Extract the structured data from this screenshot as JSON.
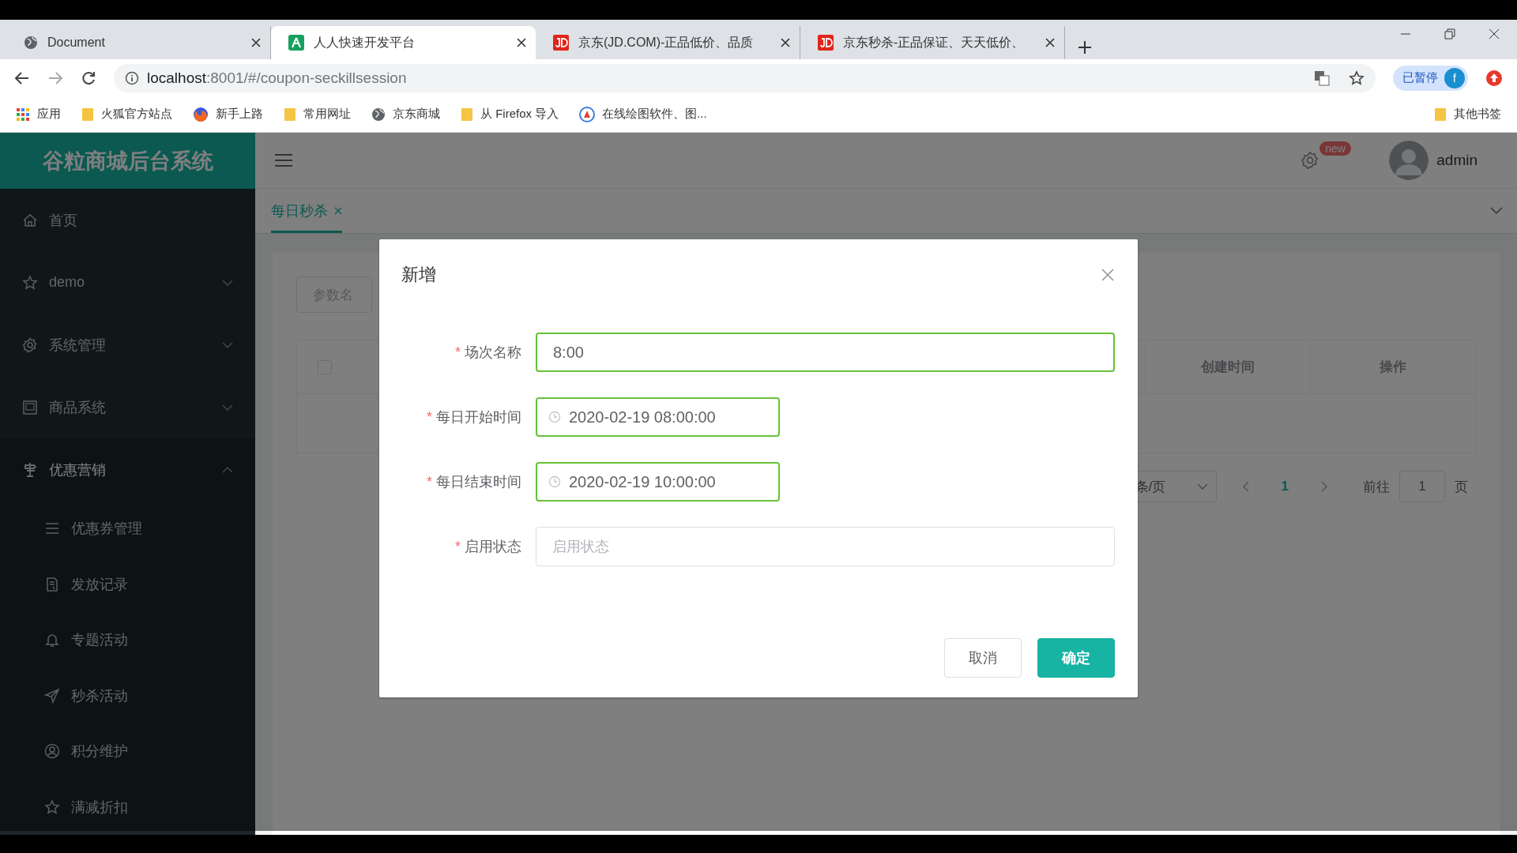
{
  "browser": {
    "tabs": [
      {
        "title": "Document",
        "selected": false
      },
      {
        "title": "人人快速开发平台",
        "selected": true
      },
      {
        "title": "京东(JD.COM)-正品低价、品质",
        "selected": false
      },
      {
        "title": "京东秒杀-正品保证、天天低价、",
        "selected": false
      }
    ],
    "address": {
      "host": "localhost",
      "rest": ":8001/#/coupon-seckillsession"
    },
    "profile": {
      "label": "已暂停",
      "initial": "f"
    },
    "bookmarks": [
      {
        "label": "应用"
      },
      {
        "label": "火狐官方站点"
      },
      {
        "label": "新手上路"
      },
      {
        "label": "常用网址"
      },
      {
        "label": "京东商城"
      },
      {
        "label": "从 Firefox 导入"
      },
      {
        "label": "在线绘图软件、图..."
      }
    ],
    "other_bookmarks": "其他书签"
  },
  "app": {
    "brand": "谷粒商城后台系统",
    "sidebar": [
      {
        "label": "首页",
        "kind": "link"
      },
      {
        "label": "demo",
        "kind": "group",
        "expanded": false
      },
      {
        "label": "系统管理",
        "kind": "group",
        "expanded": false
      },
      {
        "label": "商品系统",
        "kind": "group",
        "expanded": false
      },
      {
        "label": "优惠营销",
        "kind": "group",
        "expanded": true,
        "children": [
          {
            "label": "优惠券管理"
          },
          {
            "label": "发放记录"
          },
          {
            "label": "专题活动"
          },
          {
            "label": "秒杀活动"
          },
          {
            "label": "积分维护"
          },
          {
            "label": "满减折扣"
          }
        ]
      }
    ],
    "user": {
      "name": "admin",
      "badge": "new"
    },
    "page_tabs": [
      {
        "label": "每日秒杀",
        "selected": true
      }
    ],
    "search": {
      "placeholder": "参数名"
    },
    "table": {
      "select_all": {
        "checked": false
      },
      "columns": [
        "创建时间",
        "操作"
      ]
    },
    "pagination": {
      "page_size": "条/页",
      "current_page": "1",
      "goto_label": "前往",
      "goto_value": "1",
      "page_unit": "页"
    }
  },
  "dialog": {
    "title": "新增",
    "fields": [
      {
        "mark": "*",
        "label": "场次名称",
        "kind": "text",
        "value": "8:00"
      },
      {
        "mark": "*",
        "label": "每日开始时间",
        "kind": "datetime",
        "value": "2020-02-19 08:00:00"
      },
      {
        "mark": "*",
        "label": "每日结束时间",
        "kind": "datetime",
        "value": "2020-02-19 10:00:00"
      },
      {
        "mark": "*",
        "label": "启用状态",
        "kind": "text",
        "placeholder": "启用状态"
      }
    ],
    "buttons": [
      {
        "label": "取消",
        "kind": "default"
      },
      {
        "label": "确定",
        "kind": "primary"
      }
    ]
  }
}
